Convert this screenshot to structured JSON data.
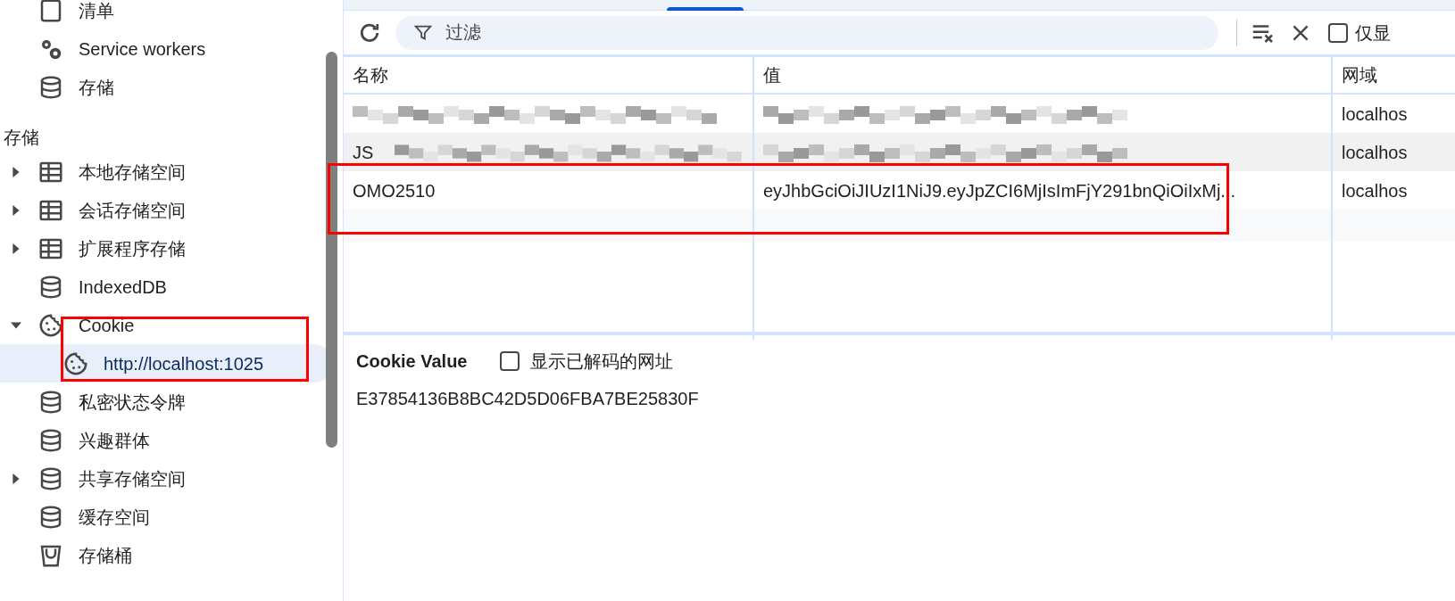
{
  "sidebar": {
    "items": [
      {
        "label": "清单",
        "kind": "item"
      },
      {
        "label": "Service workers",
        "kind": "item"
      },
      {
        "label": "存储",
        "kind": "item"
      },
      {
        "label": "存储",
        "kind": "heading"
      },
      {
        "label": "本地存储空间",
        "kind": "item",
        "expanded": false
      },
      {
        "label": "会话存储空间",
        "kind": "item",
        "expanded": false
      },
      {
        "label": "扩展程序存储",
        "kind": "item",
        "expanded": false
      },
      {
        "label": "IndexedDB",
        "kind": "item"
      },
      {
        "label": "Cookie",
        "kind": "item",
        "expanded": true,
        "children": [
          {
            "label": "http://localhost:1025",
            "selected": true,
            "highlighted": true
          }
        ]
      },
      {
        "label": "私密状态令牌",
        "kind": "item"
      },
      {
        "label": "兴趣群体",
        "kind": "item"
      },
      {
        "label": "共享存储空间",
        "kind": "item",
        "expanded": false
      },
      {
        "label": "缓存空间",
        "kind": "item"
      },
      {
        "label": "存储桶",
        "kind": "item"
      }
    ]
  },
  "toolbar": {
    "filter_placeholder": "过滤",
    "only_checkbox": {
      "label": "仅显",
      "checked": false
    }
  },
  "table": {
    "columns": [
      "名称",
      "值",
      "网域"
    ],
    "rows": [
      {
        "name": "",
        "value": "",
        "domain": "localhos",
        "redacted": true,
        "selected": false,
        "highlighted": false
      },
      {
        "name": "JS",
        "value": "",
        "domain": "localhos",
        "redacted": true,
        "selected": true,
        "highlighted": false
      },
      {
        "name": "OMO2510",
        "value": "eyJhbGciOiJIUzI1NiJ9.eyJpZCI6MjIsImFjY291bnQiOiIxMj...",
        "domain": "localhos",
        "redacted": false,
        "selected": false,
        "highlighted": true
      }
    ]
  },
  "detail": {
    "title": "Cookie Value",
    "decode_checkbox": {
      "label": "显示已解码的网址",
      "checked": false
    },
    "value": "E37854136B8BC42D5D06FBA7BE25830F"
  }
}
